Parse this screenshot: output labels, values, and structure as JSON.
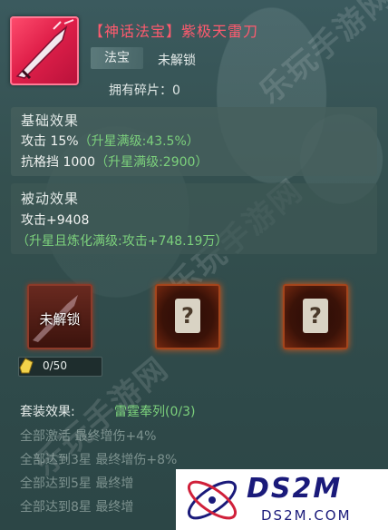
{
  "item": {
    "title": "【神话法宝】紫极天雷刀",
    "type_label": "法宝",
    "state_label": "未解锁",
    "fragments_text": "拥有碎片：0"
  },
  "base_effect": {
    "title": "基础效果",
    "lines": [
      {
        "main": "攻击 15%",
        "extra": "（升星满级:43.5%）"
      },
      {
        "main": "抗格挡 1000",
        "extra": "（升星满级:2900）"
      }
    ]
  },
  "passive_effect": {
    "title": "被动效果",
    "main": "攻击+9408",
    "extra": "（升星且炼化满级:攻击+748.19万）"
  },
  "slots": {
    "locked_label": "未解锁",
    "unknown_label": "?",
    "progress_text": "0/50",
    "progress_fraction": 0.0
  },
  "set_effect": {
    "title": "套装效果:",
    "name": "雷霆奉列(0/3)",
    "lines": [
      "全部激活 最终增伤+4%",
      "全部达到3星 最终增伤+8%",
      "全部达到5星 最终增",
      "全部达到8星 最终增"
    ]
  },
  "watermarks": [
    "乐玩手游网",
    "乐玩手游网",
    "乐玩手游网"
  ],
  "logo": {
    "big": "DS2M",
    "small": "DS2M.COM"
  },
  "colors": {
    "title_red": "#ff5a6e",
    "green": "#7cd17c",
    "panel": "#3c5555"
  }
}
